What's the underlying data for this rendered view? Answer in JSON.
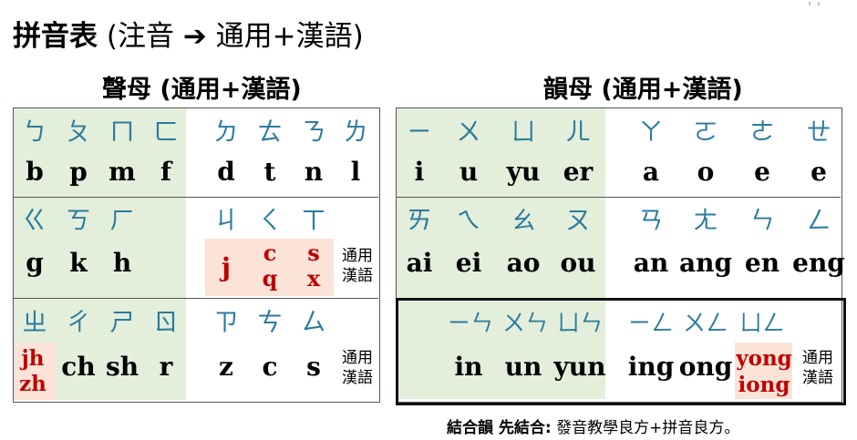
{
  "title": {
    "main": "拼音表",
    "rest": "(注音 ➔ 通用+漢語)"
  },
  "left_title": "聲母 (通用+漢語)",
  "right_title": "韻母 (通用+漢語)",
  "note": {
    "line1": "通用",
    "line2": "漢語"
  },
  "left": {
    "row1": {
      "zy": [
        "ㄅ",
        "ㄆ",
        "ㄇ",
        "ㄈ",
        "ㄉ",
        "ㄊ",
        "ㄋ",
        "ㄌ"
      ],
      "lat": [
        "b",
        "p",
        "m",
        "f",
        "d",
        "t",
        "n",
        "l"
      ]
    },
    "row2": {
      "zy": [
        "ㄍ",
        "ㄎ",
        "ㄏ",
        "ㄐ",
        "ㄑ",
        "ㄒ"
      ],
      "lat": [
        "g",
        "k",
        "h",
        "j"
      ],
      "q_top": "c",
      "q_bot": "q",
      "x_top": "s",
      "x_bot": "x"
    },
    "row3": {
      "zy": [
        "ㄓ",
        "ㄔ",
        "ㄕ",
        "ㄖ",
        "ㄗ",
        "ㄘ",
        "ㄙ"
      ],
      "zh_top": "jh",
      "zh_bot": "zh",
      "lat": [
        "ch",
        "sh",
        "r",
        "z",
        "c",
        "s"
      ]
    }
  },
  "right": {
    "row1": {
      "zy": [
        "ㄧ",
        "ㄨ",
        "ㄩ",
        "ㄦ",
        "ㄚ",
        "ㄛ",
        "ㄜ",
        "ㄝ"
      ],
      "lat": [
        "i",
        "u",
        "yu",
        "er",
        "a",
        "o",
        "e",
        "e"
      ]
    },
    "row2": {
      "zy": [
        "ㄞ",
        "ㄟ",
        "ㄠ",
        "ㄡ",
        "ㄢ",
        "ㄤ",
        "ㄣ",
        "ㄥ"
      ],
      "lat": [
        "ai",
        "ei",
        "ao",
        "ou",
        "an",
        "ang",
        "en",
        "eng"
      ]
    },
    "row3": {
      "zy": [
        "ㄧㄣ",
        "ㄨㄣ",
        "ㄩㄣ",
        "ㄧㄥ",
        "ㄨㄥ",
        "ㄩㄥ"
      ],
      "lat": [
        "in",
        "un",
        "yun",
        "ing",
        "ong"
      ],
      "yong_top": "yong",
      "yong_bot": "iong"
    }
  },
  "footer": {
    "bold": "結合韻 先結合:",
    "rest": "發音教學良方+拼音良方。"
  },
  "colors": {
    "zhuyin": "#2a7b9c",
    "red": "#c00000",
    "green_bg": "#e3eedb",
    "pink_bg": "#fbe3d8"
  }
}
